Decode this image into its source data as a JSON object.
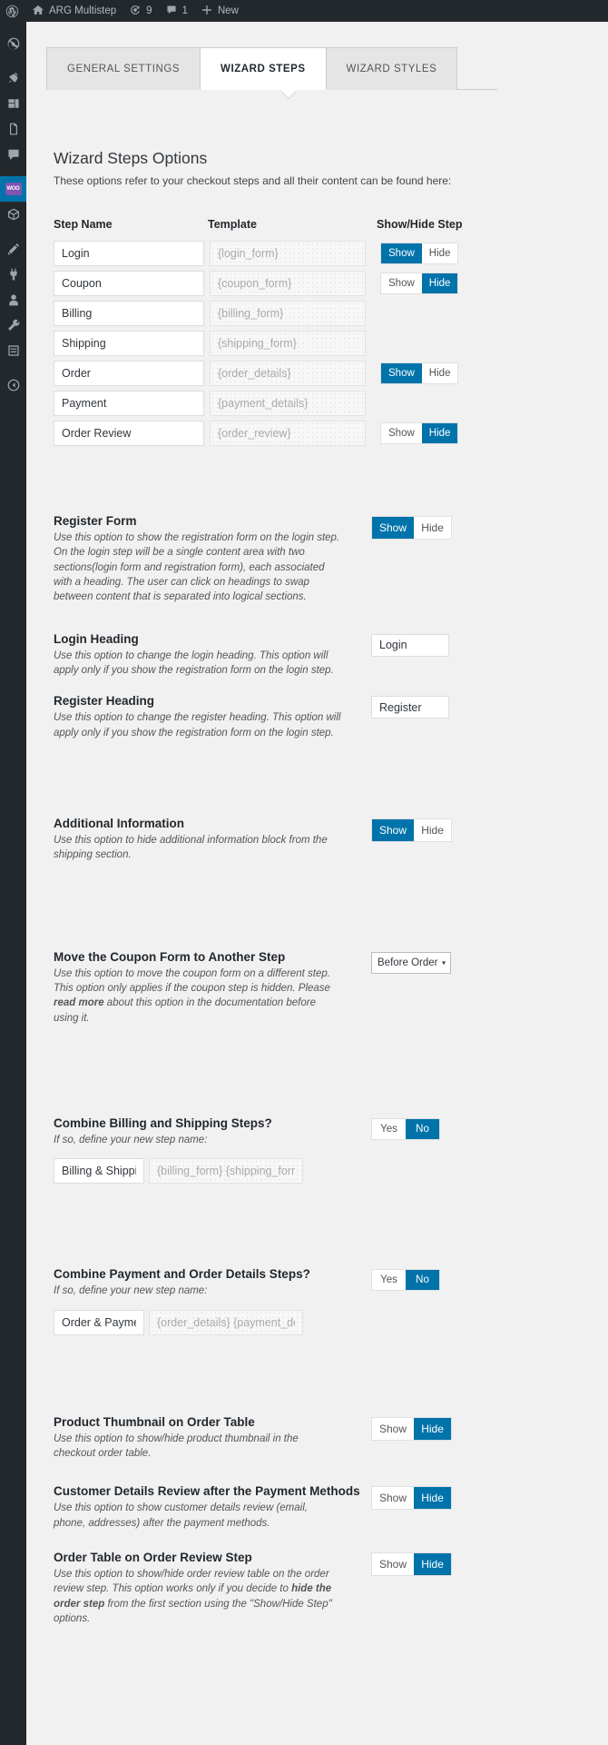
{
  "adminbar": {
    "logo_icon": "wordpress-logo-icon",
    "site_home_icon": "home-icon",
    "site_name": "ARG Multistep",
    "updates_icon": "updates-icon",
    "updates_count": "9",
    "comments_icon": "comment-bubble-icon",
    "comments_count": "1",
    "new_icon": "plus-icon",
    "new_label": "New"
  },
  "adminmenu": {
    "items": [
      {
        "name": "sidebar-item-dashboard",
        "icon": "dashboard-icon"
      },
      {
        "name": "sidebar-item-posts",
        "icon": "pin-icon"
      },
      {
        "name": "sidebar-item-media",
        "icon": "media-icon"
      },
      {
        "name": "sidebar-item-pages",
        "icon": "page-icon"
      },
      {
        "name": "sidebar-item-comments",
        "icon": "comment-bubble-icon"
      },
      {
        "name": "sidebar-item-woocommerce",
        "icon": "woo-icon"
      },
      {
        "name": "sidebar-item-products",
        "icon": "products-box-icon"
      },
      {
        "name": "sidebar-item-appearance",
        "icon": "appearance-brush-icon"
      },
      {
        "name": "sidebar-item-plugins",
        "icon": "plugins-plug-icon"
      },
      {
        "name": "sidebar-item-users",
        "icon": "user-icon"
      },
      {
        "name": "sidebar-item-tools",
        "icon": "wrench-icon"
      },
      {
        "name": "sidebar-item-settings",
        "icon": "settings-sliders-icon"
      },
      {
        "name": "sidebar-item-collapse",
        "icon": "collapse-arrow-icon"
      }
    ]
  },
  "tabs": [
    {
      "label": "GENERAL SETTINGS",
      "active": false
    },
    {
      "label": "WIZARD STEPS",
      "active": true
    },
    {
      "label": "WIZARD STYLES",
      "active": false
    }
  ],
  "panel": {
    "title": "Wizard Steps Options",
    "description": "These options refer to your checkout steps and all their content can be found here:"
  },
  "steps_table": {
    "headers": {
      "step_name": "Step Name",
      "template": "Template",
      "show_hide": "Show/Hide Step"
    },
    "toggle_labels": {
      "show": "Show",
      "hide": "Hide"
    },
    "rows": [
      {
        "name": "Login",
        "template": "{login_form}",
        "state": "show"
      },
      {
        "name": "Coupon",
        "template": "{coupon_form}",
        "state": "hide"
      },
      {
        "name": "Billing",
        "template": "{billing_form}",
        "state": "none"
      },
      {
        "name": "Shipping",
        "template": "{shipping_form}",
        "state": "none"
      },
      {
        "name": "Order",
        "template": "{order_details}",
        "state": "show"
      },
      {
        "name": "Payment",
        "template": "{payment_details}",
        "state": "none"
      },
      {
        "name": "Order Review",
        "template": "{order_review}",
        "state": "hide"
      }
    ]
  },
  "options": {
    "register_form": {
      "title": "Register Form",
      "desc": "Use this option to show the registration form on the login step. On the login step will be a single content area with two sections(login form and registration form), each associated with a heading. The user can click on headings to swap between content that is separated into logical sections.",
      "show": "Show",
      "hide": "Hide",
      "state": "show"
    },
    "login_heading": {
      "title": "Login Heading",
      "desc": "Use this option to change the login heading. This option will apply only if you show the registration form on the login step.",
      "value": "Login"
    },
    "register_heading": {
      "title": "Register Heading",
      "desc": "Use this option to change the register heading. This option will apply only if you show the registration form on the login step.",
      "value": "Register"
    },
    "additional_information": {
      "title": "Additional Information",
      "desc": "Use this option to hide additional information block from the shipping section.",
      "show": "Show",
      "hide": "Hide",
      "state": "show"
    },
    "move_coupon": {
      "title": "Move the Coupon Form to Another Step",
      "desc_1": "Use this option to move the coupon form on a different step. This option only applies if the coupon step is hidden. Please ",
      "desc_link": "read more",
      "desc_2": " about this option in the documentation before using it.",
      "selected": "Before Order",
      "options": [
        "Before Order"
      ]
    },
    "combine_billing_shipping": {
      "title": "Combine Billing and Shipping Steps?",
      "desc": "If so, define your new step name:",
      "yes": "Yes",
      "no": "No",
      "state": "no",
      "step_name": "Billing & Shipping",
      "template": "{billing_form} {shipping_form}"
    },
    "combine_payment_order": {
      "title": "Combine Payment and Order Details Steps?",
      "desc": "If so, define your new step name:",
      "yes": "Yes",
      "no": "No",
      "state": "no",
      "step_name": "Order & Payment",
      "template": "{order_details} {payment_details}"
    },
    "product_thumbnail": {
      "title": "Product Thumbnail on Order Table",
      "desc": "Use this option to show/hide product thumbnail in the checkout order table.",
      "show": "Show",
      "hide": "Hide",
      "state": "hide"
    },
    "customer_details_review": {
      "title": "Customer Details Review after the Payment Methods",
      "desc": "Use this option to show customer details review (email, phone, addresses) after the payment methods.",
      "show": "Show",
      "hide": "Hide",
      "state": "hide"
    },
    "order_table_review": {
      "title": "Order Table on Order Review Step",
      "desc_1": "Use this option to show/hide order review table on the order review step. This option works only if you decide to ",
      "desc_bold": "hide the order step",
      "desc_2": " from the first section using the \"Show/Hide Step\" options.",
      "show": "Show",
      "hide": "Hide",
      "state": "hide"
    }
  },
  "colors": {
    "accent": "#0073aa",
    "adminbar_bg": "#23282d",
    "page_bg": "#f1f1f1",
    "woo_purple": "#7f54b3"
  }
}
